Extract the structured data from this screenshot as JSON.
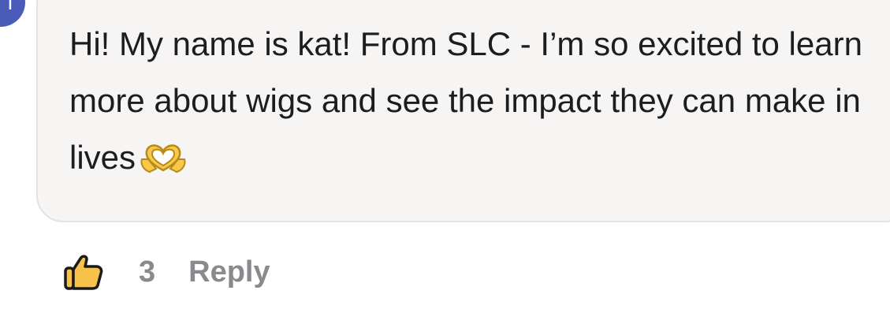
{
  "comment": {
    "avatar_initial": "T",
    "text": "Hi! My name is kat! From SLC - I’m so excited to learn more about wigs and see the impact they can make in lives",
    "emoji": "heart-hands-emoji"
  },
  "actions": {
    "like_icon": "thumbs-up-icon",
    "like_count": "3",
    "reply_label": "Reply"
  },
  "colors": {
    "avatar_bg": "#4b5bb8",
    "bubble_bg": "#f6f5f4",
    "bubble_border": "#e3e2e0",
    "text": "#1d1d1f",
    "muted": "#8a8a8e",
    "like_fill": "#f6c24a"
  }
}
